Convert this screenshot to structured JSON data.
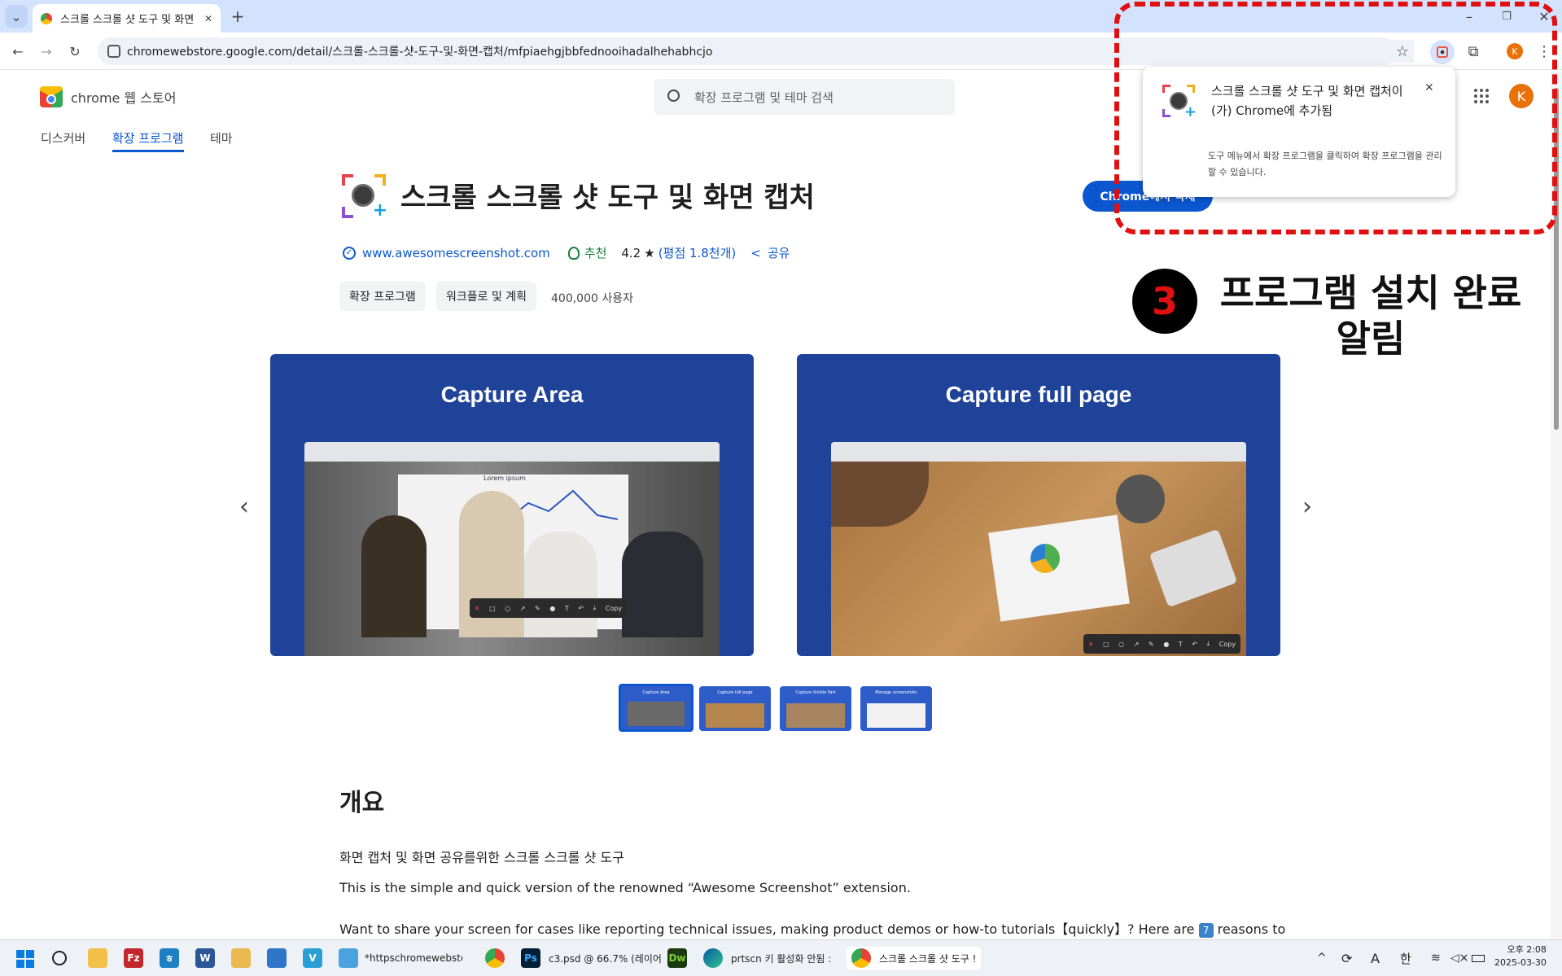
{
  "browser": {
    "tab_title": "스크롤 스크롤 샷 도구 및 화면",
    "url": "chromewebstore.google.com/detail/스크롤-스크롤-샷-도구-및-화면-캡처/mfpiaehgjbbfednooihadalhehabhcjo",
    "profile_initial": "K",
    "win_minimize": "–",
    "win_restore": "❐",
    "win_close": "✕",
    "new_tab": "+",
    "tab_close": "✕",
    "tab_list": "⌄",
    "back": "←",
    "forward": "→",
    "reload": "↻",
    "star": "☆",
    "puzzle": "⧉",
    "menu": "⋮"
  },
  "store": {
    "logo_text": "chrome 웹 스토어",
    "search_placeholder": "확장 프로그램 및 테마 검색",
    "nav": [
      "디스커버",
      "확장 프로그램",
      "테마"
    ],
    "apps_icon": "⋮⋮⋮",
    "profile_initial": "K"
  },
  "extension": {
    "title": "스크롤 스크롤 샷 도구 및 화면 캡처",
    "website": "www.awesomescreenshot.com",
    "featured": "추천",
    "rating": "4.2",
    "rating_star": "★",
    "reviews": "평점 1.8천개",
    "share": "공유",
    "chips": [
      "확장 프로그램",
      "워크플로 및 계획"
    ],
    "users": "400,000 사용자",
    "action_button": "Chrome에서 삭제"
  },
  "carousel": {
    "slides": [
      {
        "caption": "Capture Area",
        "inner_label": "Lorem ipsum"
      },
      {
        "caption": "Capture full page"
      }
    ],
    "thumbs": [
      "Capture Area",
      "Capture full page",
      "Capture Visible Part",
      "Manage screenshots"
    ],
    "prev": "‹",
    "next": "›",
    "tool_label": "Copy"
  },
  "overview": {
    "heading": "개요",
    "line1": "화면 캡처 및 화면 공유를위한 스크롤 스크롤 샷 도구",
    "line2": "This is the simple and quick version of the renowned “Awesome Screenshot” extension.",
    "line3_pre": "Want to share your screen for cases like reporting technical issues, making product demos or how-to tutorials【quickly】?  Here are ",
    "line3_badge": "7",
    "line3_post": " reasons to"
  },
  "popup": {
    "title": "스크롤 스크롤 샷 도구 및 화면 캡처이(가) Chrome에 추가됨",
    "body": "도구 메뉴에서 확장 프로그램을 클릭하여 확장 프로그램을 관리할 수 있습니다.",
    "close": "✕"
  },
  "annotation": {
    "number": "3",
    "text": "프로그램 설치 완료 알림",
    "color": "#e01010"
  },
  "taskbar": {
    "items": [
      {
        "icon": "notepad",
        "label": "*httpschromewebstore.g"
      },
      {
        "icon": "chrome",
        "label": ""
      },
      {
        "icon": "photoshop",
        "label": "c3.psd @ 66.7% (레이어"
      },
      {
        "icon": "dreamweaver",
        "label": ""
      },
      {
        "icon": "edge",
        "label": "prtscn 키 활성화 안됨 :"
      },
      {
        "icon": "chrome",
        "label": "스크롤 스크롤 샷 도구 !"
      }
    ],
    "tray_up": "^",
    "ime_a": "A",
    "ime": "한",
    "time": "오후 2:08",
    "date": "2025-03-30"
  }
}
